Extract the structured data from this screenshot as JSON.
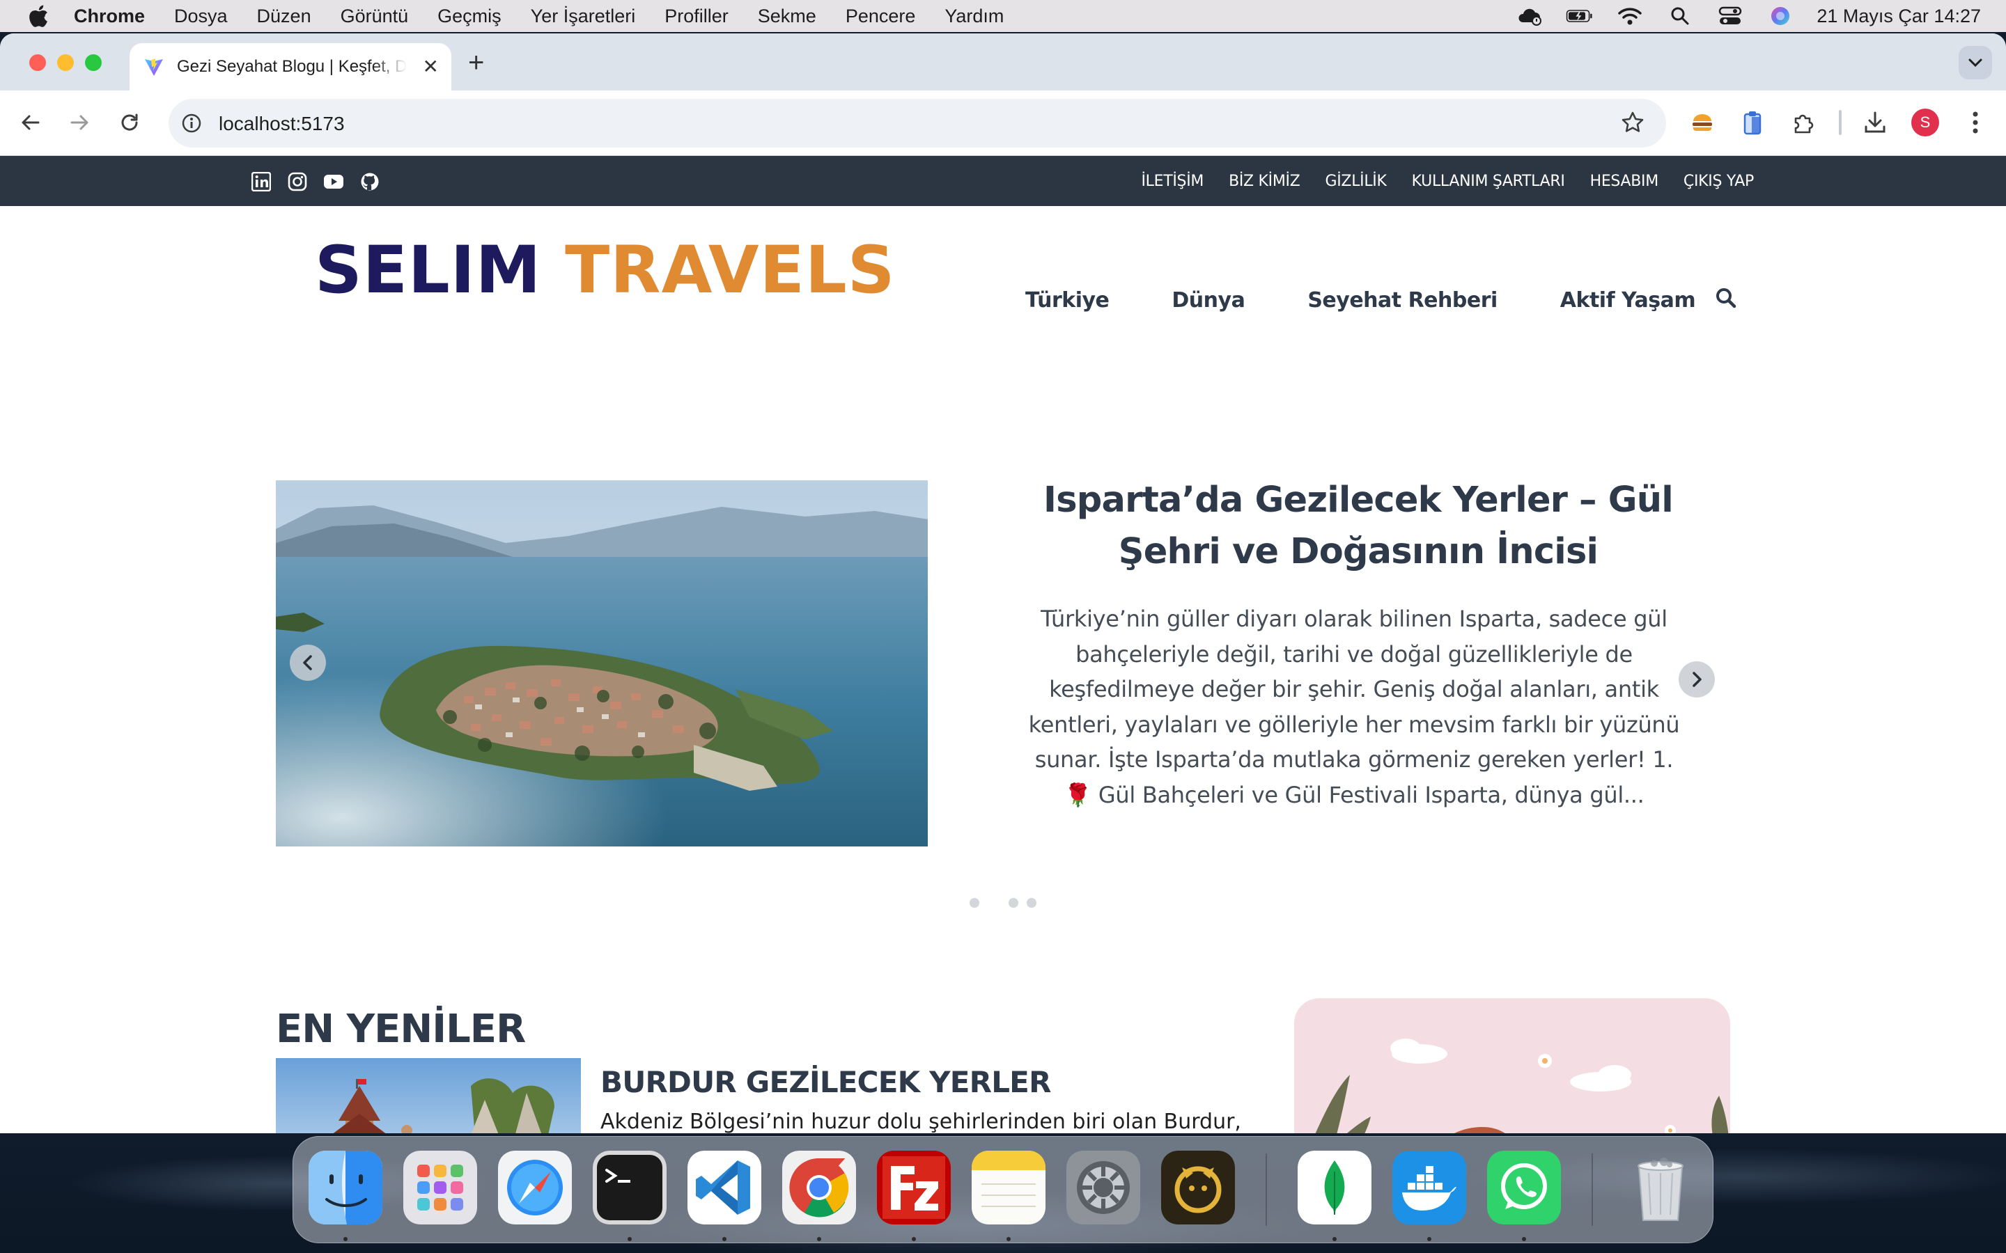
{
  "menubar": {
    "app": "Chrome",
    "items": [
      "Dosya",
      "Düzen",
      "Görüntü",
      "Geçmiş",
      "Yer İşaretleri",
      "Profiller",
      "Sekme",
      "Pencere",
      "Yardım"
    ],
    "clock": "21 Mayıs Çar  14:27"
  },
  "browser": {
    "tab_title": "Gezi Seyahat Blogu | Keşfet, D",
    "url": "localhost:5173",
    "profile_initial": "S"
  },
  "site": {
    "top_links": [
      "İLETİŞİM",
      "BİZ KİMİZ",
      "GİZLİLİK",
      "KULLANIM ŞARTLARI",
      "HESABIM",
      "ÇIKIŞ YAP"
    ],
    "logo_part1": "SELIM",
    "logo_part2": "TRAVELS",
    "nav": [
      "Türkiye",
      "Dünya",
      "Seyehat Rehberi",
      "Aktif Yaşam"
    ],
    "slider": {
      "title": "Isparta’da Gezilecek Yerler – Gül Şehri ve Doğasının İncisi",
      "description": "Türkiye’nin güller diyarı olarak bilinen Isparta, sadece gül bahçeleriyle değil, tarihi ve doğal güzellikleriyle de keşfedilmeye değer bir şehir. Geniş doğal alanları, antik kentleri, yaylaları ve gölleriyle her mevsim farklı bir yüzünü sunar. İşte Isparta’da mutlaka görmeniz gereken yerler! 1. 🌹 Gül Bahçeleri ve Gül Festivali Isparta, dünya gül..."
    },
    "latest": {
      "heading": "EN YENİLER",
      "post_title": "BURDUR GEZİLECEK YERLER",
      "post_excerpt": "Akdeniz Bölgesi’nin huzur dolu şehirlerinden biri olan Burdur, hem tarihi zenginlikleri hem de doğa harikalarıyla dikkat çeken,"
    }
  },
  "colors": {
    "topstrip": "#2b3642",
    "logo_primary": "#1d1b5e",
    "logo_accent": "#e08a32",
    "heading": "#2e3a4a"
  },
  "dock_apps": [
    "finder-icon",
    "launchpad-icon",
    "safari-icon",
    "terminal-icon",
    "vscode-icon",
    "chrome-icon",
    "filezilla-icon",
    "notes-icon",
    "system-settings-icon",
    "navicat-icon",
    "mongodb-compass-icon",
    "docker-icon",
    "whatsapp-icon",
    "trash-icon"
  ]
}
